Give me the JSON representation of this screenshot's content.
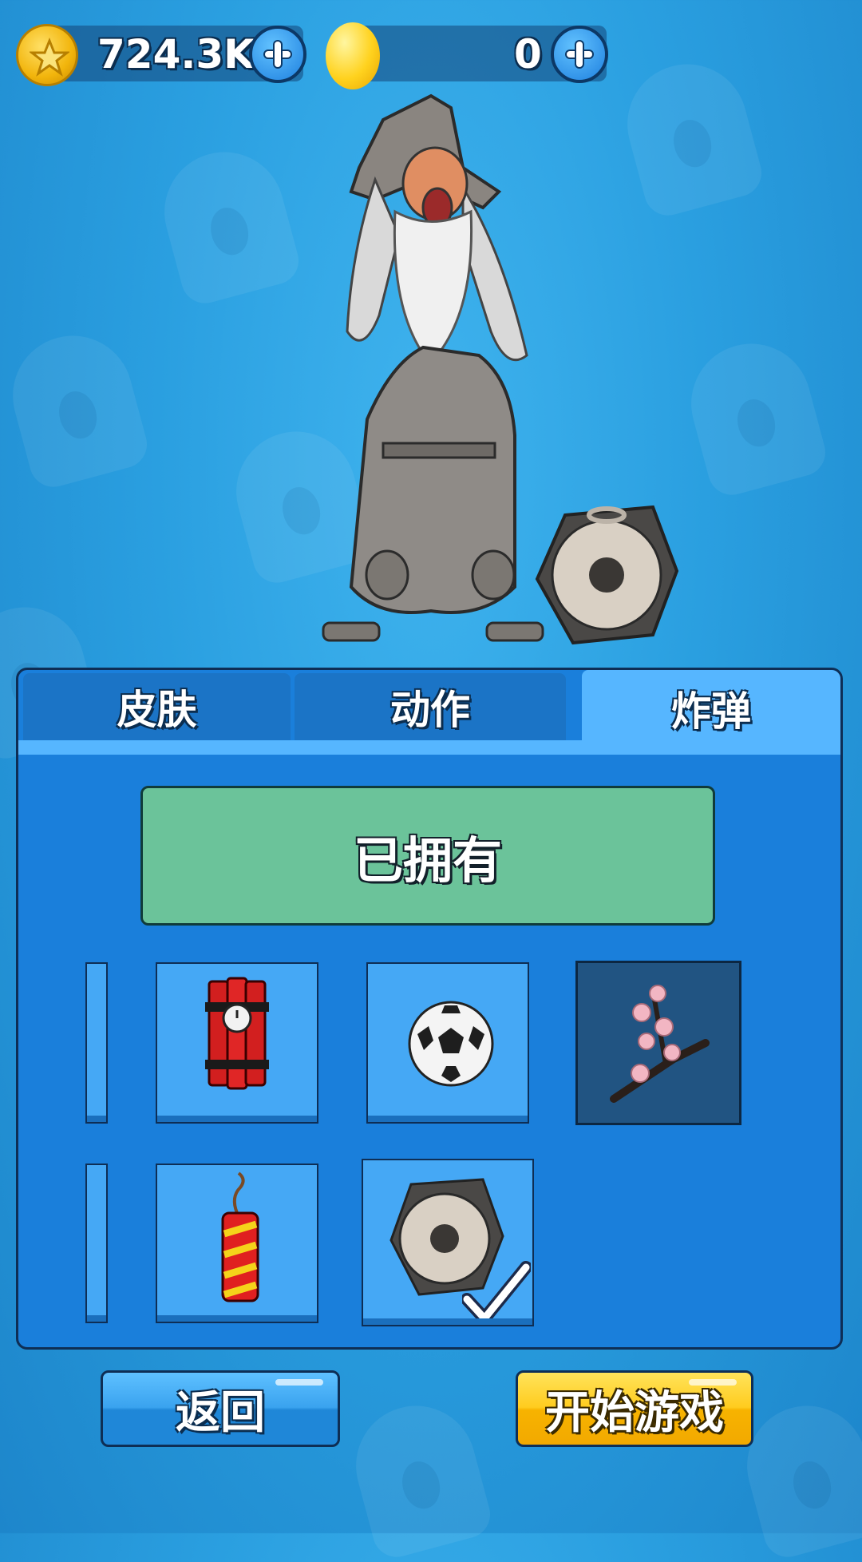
{
  "currency": {
    "coins": "724.3K",
    "gems": "0"
  },
  "tabs": [
    {
      "label": "皮肤",
      "active": false
    },
    {
      "label": "动作",
      "active": false
    },
    {
      "label": "炸弹",
      "active": true
    }
  ],
  "status_banner": "已拥有",
  "items": [
    {
      "icon": "dynamite-bundle-icon",
      "selected": false,
      "equipped": false
    },
    {
      "icon": "soccer-ball-icon",
      "selected": false,
      "equipped": false
    },
    {
      "icon": "cherry-blossom-branch-icon",
      "selected": true,
      "equipped": false
    },
    {
      "icon": "firecracker-icon",
      "selected": false,
      "equipped": false
    },
    {
      "icon": "gong-icon",
      "selected": false,
      "equipped": true
    }
  ],
  "buttons": {
    "back": "返回",
    "start": "开始游戏"
  },
  "colors": {
    "background": "#2a9fe0",
    "panel": "#1a7fdb",
    "active_tab": "#56b6ff",
    "owned_banner": "#6bc39a",
    "start_button": "#ffcc1f"
  }
}
